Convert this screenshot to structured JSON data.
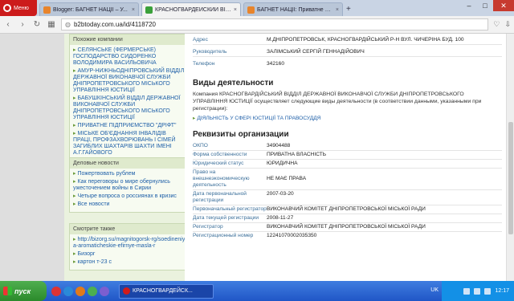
{
  "browser": {
    "menu_label": "Меню",
    "tabs": [
      {
        "title": "Blogger: БАГНЕТ НАЦІЇ – У...",
        "color": "#e8842b",
        "active": false
      },
      {
        "title": "КРАСНОГВАРДЕЙСКИЙ ВІДД...",
        "color": "#3aa03a",
        "active": true
      },
      {
        "title": "БАГНЕТ НАЦІЇ: Приватне П...",
        "color": "#e8842b",
        "active": false
      }
    ],
    "new_tab": "+",
    "url": "b2btoday.com.ua/id/4118720",
    "minimize": "–",
    "maximize": "□",
    "close": "✕"
  },
  "sidebar": {
    "box1": {
      "title": "Похожие компании",
      "links": [
        "СЕЛЯНСЬКЕ (ФЕРМЕРСЬКЕ) ГОСПОДАРСТВО СИДОРЕНКО ВОЛОДИМИРА ВАСИЛЬОВИЧА",
        "АМУР-НИЖНЬОДНІПРОВСЬКИЙ ВІДДІЛ ДЕРЖАВНОЇ ВИКОНАВЧОЇ СЛУЖБИ ДНІПРОПЕТРОВСЬКОГО МІСЬКОГО УПРАВЛІННЯ ЮСТИЦІЇ",
        "БАБУШКІНСЬКИЙ ВІДДІЛ ДЕРЖАВНОЇ ВИКОНАВЧОЇ СЛУЖБИ ДНІПРОПЕТРОВСЬКОГО МІСЬКОГО УПРАВЛІННЯ ЮСТИЦІЇ",
        "ПРИВАТНЕ ПІДПРИЄМСТВО \"ДРІФТ\"",
        "МІСЬКЕ ОБ'ЄДНАННЯ ІНВАЛІДІВ ПРАЦІ, ПРОФЗАХВОРЮВАНЬ І СІМЕЙ ЗАГИБЛИХ ШАХТАРІВ ШАХТИ ІМЕНІ А.Г.ГАЙОВОГО"
      ]
    },
    "box2": {
      "title": "Деловые новости",
      "links": [
        "Пожертвовать рублем",
        "Как переговоры о мире обернулись ужесточением войны в Сирии",
        "Четыре вопроса о россиянах в кризис",
        "Все новости"
      ]
    },
    "box3": {
      "title": "Смотрите также",
      "links": [
        "http://bizorg.su/magnitogorsk-rg/soedineniya-aromaticheskie-efirnye-masla-r",
        "Бизорг",
        "картон т-23 с"
      ]
    }
  },
  "main": {
    "top_rows": [
      {
        "key": "Адрес",
        "value": "М.ДНІПРОПЕТРОВСЬК, КРАСНОГВАРДІЙСЬКИЙ Р-Н ВУЛ. ЧИЧЕРІНА БУД. 100"
      },
      {
        "key": "Руководитель",
        "value": "ЗАЛІМСЬКИЙ СЕРГІЙ ГЕННАДІЙОВИЧ"
      },
      {
        "key": "Телефон",
        "value": "342160"
      }
    ],
    "activities_title": "Виды деятельности",
    "activities_text": "Компания КРАСНОГВАРДІЙСЬКИЙ ВІДДІЛ ДЕРЖАВНОЇ ВИКОНАВЧОЇ СЛУЖБИ ДНІПРОПЕТРОВСЬКОГО УПРАВЛІННЯ ЮСТИЦІЇ осуществляет следующие виды деятельности (в соответствии данными, указанными при регистрации):",
    "activity_link": "ДІЯЛЬНІСТЬ У СФЕРІ ЮСТИЦІЇ ТА ПРАВОСУДДЯ",
    "requisites_title": "Реквизиты организации",
    "requisites": [
      {
        "key": "ОКПО",
        "value": "34904488"
      },
      {
        "key": "Форма собственности",
        "value": "ПРИВАТНА ВЛАСНІСТЬ"
      },
      {
        "key": "Юридический статус",
        "value": "ЮРИДИЧНА"
      },
      {
        "key": "Право на внешнеэкономическую деятельность",
        "value": "НЕ МАЄ ПРАВА"
      },
      {
        "key": "Дата первоначальной регистрации",
        "value": "2007-03-20"
      },
      {
        "key": "Первоначальный регистратор",
        "value": "ВИКОНАВЧИЙ КОМІТЕТ ДНІПРОПЕТРОВСЬКОЇ МІСЬКОЇ РАДИ"
      },
      {
        "key": "Дата текущей регистрации",
        "value": "2008-11-27"
      },
      {
        "key": "Регистратор",
        "value": "ВИКОНАВЧИЙ КОМІТЕТ ДНІПРОПЕТРОВСЬКОЇ МІСЬКОЇ РАДИ"
      },
      {
        "key": "Регистрационный номер",
        "value": "12241070002035350"
      }
    ]
  },
  "taskbar": {
    "start_label": "пуск",
    "task_label": "КРАСНОГВАРДЕЙСК...",
    "lang": "UK",
    "clock": "12:17"
  }
}
